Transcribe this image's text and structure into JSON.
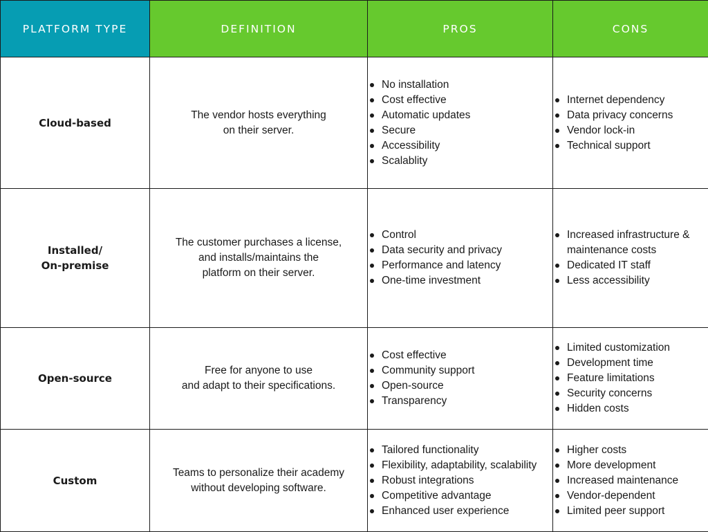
{
  "colors": {
    "header_first": "#069db3",
    "header_other": "#66c92e",
    "header_text": "#ffffff",
    "border": "#1b1b1b",
    "text": "#1a1a1a"
  },
  "headers": [
    "PLATFORM TYPE",
    "DEFINITION",
    "PROS",
    "CONS"
  ],
  "rows": [
    {
      "type_lines": [
        "Cloud-based"
      ],
      "definition_lines": [
        "The vendor hosts everything",
        "on their server."
      ],
      "pros": [
        "No installation",
        "Cost effective",
        "Automatic updates",
        "Secure",
        "Accessibility",
        "Scalablity"
      ],
      "cons": [
        "Internet dependency",
        "Data privacy concerns",
        "Vendor lock-in",
        "Technical support"
      ]
    },
    {
      "type_lines": [
        "Installed/",
        "On-premise"
      ],
      "definition_lines": [
        "The customer purchases a license,",
        "and installs/maintains the",
        "platform on their server."
      ],
      "pros": [
        "Control",
        "Data security and privacy",
        "Performance and latency",
        "One-time investment"
      ],
      "cons": [
        "Increased infrastructure & maintenance costs",
        "Dedicated IT staff",
        "Less accessibility"
      ]
    },
    {
      "type_lines": [
        "Open-source"
      ],
      "definition_lines": [
        "Free for anyone to use",
        "and adapt to their specifications."
      ],
      "pros": [
        "Cost effective",
        "Community support",
        "Open-source",
        "Transparency"
      ],
      "cons": [
        "Limited customization",
        "Development time",
        "Feature limitations",
        "Security concerns",
        "Hidden costs"
      ]
    },
    {
      "type_lines": [
        "Custom"
      ],
      "definition_lines": [
        "Teams to personalize their academy",
        "without developing software."
      ],
      "pros": [
        "Tailored functionality",
        "Flexibility, adaptability, scalability",
        "Robust integrations",
        "Competitive advantage",
        "Enhanced user experience"
      ],
      "cons": [
        "Higher costs",
        "More development",
        "Increased maintenance",
        "Vendor-dependent",
        "Limited peer support"
      ]
    }
  ]
}
